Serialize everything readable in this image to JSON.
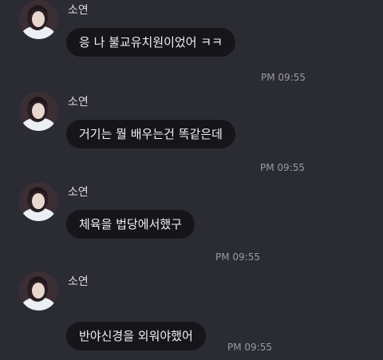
{
  "messages": [
    {
      "sender": "소연",
      "text": "응 나 불교유치원이었어 ㅋㅋ",
      "time": "PM 09:55"
    },
    {
      "sender": "소연",
      "text": "거기는 뭘 배우는건 똑같은데",
      "time": "PM 09:55"
    },
    {
      "sender": "소연",
      "text": "체육을 법당에서했구",
      "time": "PM 09:55"
    },
    {
      "sender": "소연",
      "text": "반야신경을 외워야했어",
      "time": "PM 09:55"
    }
  ]
}
